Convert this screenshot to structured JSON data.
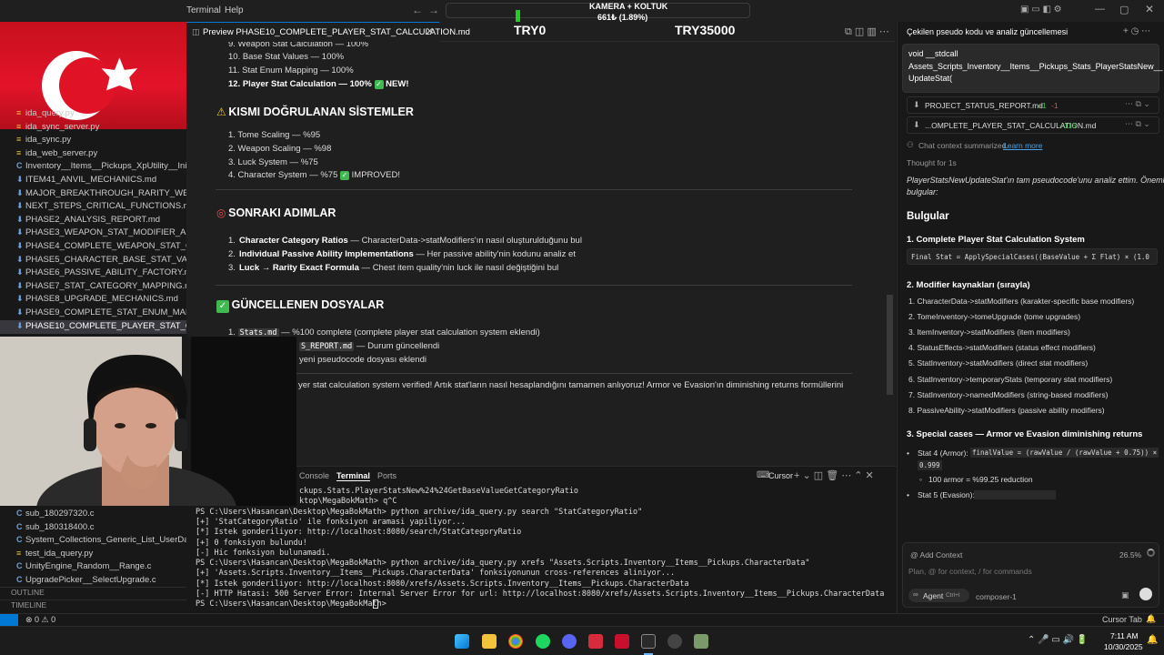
{
  "titlebar": {
    "menu_terminal": "Terminal",
    "menu_help": "Help",
    "overlay_camera": "KAMERA + KOLTUK",
    "overlay_progress": "661₺ (1.89%)",
    "overlay_try_left": "TRY0",
    "overlay_try_right": "TRY35000"
  },
  "sidebar": {
    "files": [
      {
        "icon": "py",
        "name": "ida_query.py",
        "active": false
      },
      {
        "icon": "py",
        "name": "ida_sync_server.py",
        "active": false
      },
      {
        "icon": "py",
        "name": "ida_sync.py",
        "active": false
      },
      {
        "icon": "py",
        "name": "ida_web_server.py",
        "active": false
      },
      {
        "icon": "C",
        "name": "Inventory__Items__Pickups_XpUtility__Init.c",
        "active": false
      },
      {
        "icon": "md",
        "name": "ITEM41_ANVIL_MECHANICS.md",
        "active": false
      },
      {
        "icon": "md",
        "name": "MAJOR_BREAKTHROUGH_RARITY_WEAPO...",
        "active": false
      },
      {
        "icon": "md",
        "name": "NEXT_STEPS_CRITICAL_FUNCTIONS.md",
        "active": false
      },
      {
        "icon": "md",
        "name": "PHASE2_ANALYSIS_REPORT.md",
        "active": false
      },
      {
        "icon": "md",
        "name": "PHASE3_WEAPON_STAT_MODIFIER_ANALY...",
        "active": false
      },
      {
        "icon": "md",
        "name": "PHASE4_COMPLETE_WEAPON_STAT_CALCU...",
        "active": false
      },
      {
        "icon": "md",
        "name": "PHASE5_CHARACTER_BASE_STAT_VALUES.md",
        "active": false
      },
      {
        "icon": "md",
        "name": "PHASE6_PASSIVE_ABILITY_FACTORY.md",
        "active": false
      },
      {
        "icon": "md",
        "name": "PHASE7_STAT_CATEGORY_MAPPING.md",
        "active": false
      },
      {
        "icon": "md",
        "name": "PHASE8_UPGRADE_MECHANICS.md",
        "active": false
      },
      {
        "icon": "md",
        "name": "PHASE9_COMPLETE_STAT_ENUM_MAPPING...",
        "active": false
      },
      {
        "icon": "md",
        "name": "PHASE10_COMPLETE_PLAYER_STAT_CALCU...",
        "active": true
      }
    ],
    "files_lower": [
      {
        "icon": "C",
        "name": "sub_180297320.c"
      },
      {
        "icon": "C",
        "name": "sub_180318400.c"
      },
      {
        "icon": "C",
        "name": "System_Collections_Generic_List_UserDataSt..."
      },
      {
        "icon": "py",
        "name": "test_ida_query.py"
      },
      {
        "icon": "C",
        "name": "UnityEngine_Random__Range.c"
      },
      {
        "icon": "C",
        "name": "UpgradePicker__SelectUpgrade.c"
      }
    ],
    "outline": "OUTLINE",
    "timeline": "TIMELINE"
  },
  "editor": {
    "tab_label": "Preview PHASE10_COMPLETE_PLAYER_STAT_CALCULATION.md",
    "done_list": [
      "9. Weapon Stat Calculation — 100%",
      "10. Base Stat Values — 100%",
      "11. Stat Enum Mapping — 100%"
    ],
    "done_new_bold": "12. Player Stat Calculation — 100%",
    "done_new_tag": "NEW!",
    "partial_title": "KISMI DOĞRULANAN SİSTEMLER",
    "partial_list": [
      "1. Tome Scaling — %95",
      "2. Weapon Scaling — %98",
      "3. Luck System — %75"
    ],
    "partial_last": "4. Character System — %75",
    "partial_last_tag": "IMPROVED!",
    "next_title": "SONRAKI ADIMLAR",
    "next_items": [
      {
        "num": "1.",
        "bold": "Character Category Ratios",
        "rest": " — CharacterData->statModifiers'ın nasıl oluşturulduğunu bul"
      },
      {
        "num": "2.",
        "bold": "Individual Passive Ability Implementations",
        "rest": " — Her passive ability'nin kodunu analiz et"
      },
      {
        "num": "3.",
        "bold": "Luck → Rarity Exact Formula",
        "rest": " — Chest item quality'nin luck ile nasıl değiştiğini bul"
      }
    ],
    "updated_title": "GÜNCELLENEN DOSYALAR",
    "updated_1_code": "Stats.md",
    "updated_1_rest": " — %100 complete (complete player stat calculation system eklendi)",
    "updated_2_code": "S_REPORT.md",
    "updated_2_rest": " — Durum güncellendi",
    "updated_3_rest": "yeni pseudocode dosyası eklendi",
    "footer_text": "yer stat calculation system verified! Artık stat'ların nasıl hesaplandığını tamamen anlıyoruz! Armor ve Evasion'ın diminishing returns formüllerini"
  },
  "terminal": {
    "tab_console": "Console",
    "tab_terminal": "Terminal",
    "tab_ports": "Ports",
    "shell_label": "Cursor",
    "lines": [
      "ckups.Stats.PlayerStatsNew%24%24GetBaseValueGetCategoryRatio",
      "ktop\\MegaBokMath> q^C",
      "PS C:\\Users\\Hasancan\\Desktop\\MegaBokMath> python archive/ida_query.py search \"StatCategoryRatio\"",
      "[+] 'StatCategoryRatio' ile fonksiyon aramasi yapiliyor...",
      "[*] Istek gonderiliyor: http://localhost:8080/search/StatCategoryRatio",
      "[+] 0 fonksiyon bulundu!",
      "[-] Hic fonksiyon bulunamadi.",
      "PS C:\\Users\\Hasancan\\Desktop\\MegaBokMath> python archive/ida_query.py xrefs \"Assets.Scripts.Inventory__Items__Pickups.CharacterData\"",
      "[+] 'Assets.Scripts.Inventory__Items__Pickups.CharacterData' fonksiyonunun cross-references aliniyor...",
      "[*] Istek gonderiliyor: http://localhost:8080/xrefs/Assets.Scripts.Inventory__Items__Pickups.CharacterData",
      "[-] HTTP Hatasi: 500 Server Error: Internal Server Error for url: http://localhost:8080/xrefs/Assets.Scripts.Inventory__Items__Pickups.CharacterData",
      "PS C:\\Users\\Hasancan\\Desktop\\MegaBokMath> "
    ]
  },
  "chat": {
    "header_title": "Çekilen pseudo kodu ve analiz güncellemesi",
    "user_msg_1": "void __stdcall",
    "user_msg_2": "Assets_Scripts_Inventory__Items__Pickups_Stats_PlayerStatsNew__",
    "user_msg_3": "UpdateStat(",
    "file_chip_1_name": "PROJECT_STATUS_REPORT.md",
    "file_chip_1_plus": "+1",
    "file_chip_1_minus": "-1",
    "file_chip_2_name": "...OMPLETE_PLAYER_STAT_CALCULATION.md",
    "file_chip_2_plus": "+116",
    "summarized": "Chat context summarized.",
    "learn_more": "Learn more",
    "thought": "Thought for 1s",
    "intro_1": "PlayerStatsNewUpdateStat'ın tam pseudocode'unu analiz ettim. Önemli",
    "intro_2": "bulgular:",
    "findings_title": "Bulgular",
    "sec1_title": "1. Complete Player Stat Calculation System",
    "sec1_code": "Final Stat = ApplySpecialCases((BaseValue + Σ Flat) × (1.0",
    "sec2_title": "2. Modifier kaynakları (sırayla)",
    "modifiers": [
      "1. CharacterData->statModifiers (karakter-specific base modifiers)",
      "2. TomeInventory->tomeUpgrade (tome upgrades)",
      "3. ItemInventory->statModifiers (item modifiers)",
      "4. StatusEffects->statModifiers (status effect modifiers)",
      "5. StatInventory->statModifiers (direct stat modifiers)",
      "6. StatInventory->temporaryStats (temporary stat modifiers)",
      "7. StatInventory->namedModifiers (string-based modifiers)",
      "8. PassiveAbility->statModifiers (passive ability modifiers)"
    ],
    "sec3_title": "3. Special cases — Armor ve Evasion diminishing returns",
    "armor_label": "Stat 4 (Armor):",
    "armor_code": "finalValue = (rawValue / (rawValue + 0.75)) ×",
    "armor_code_2": "0.999",
    "armor_sub": "100 armor = %99.25 reduction",
    "evasion_label": "Stat 5 (Evasion):",
    "add_context": "@ Add Context",
    "context_pct": "26.5%",
    "input_placeholder": "Plan, @ for context, / for commands",
    "agent_label": "Agent",
    "agent_shortcut": "Ctrl+I",
    "model_label": "composer-1"
  },
  "statusbar": {
    "problems": "⊗ 0 ⚠ 0",
    "right": "Cursor Tab"
  },
  "taskbar": {
    "time": "7:11 AM",
    "date": "10/30/2025"
  },
  "colors": {
    "accent": "#0078d4",
    "check_green": "#3fb950",
    "flag_red": "#e3132a"
  }
}
